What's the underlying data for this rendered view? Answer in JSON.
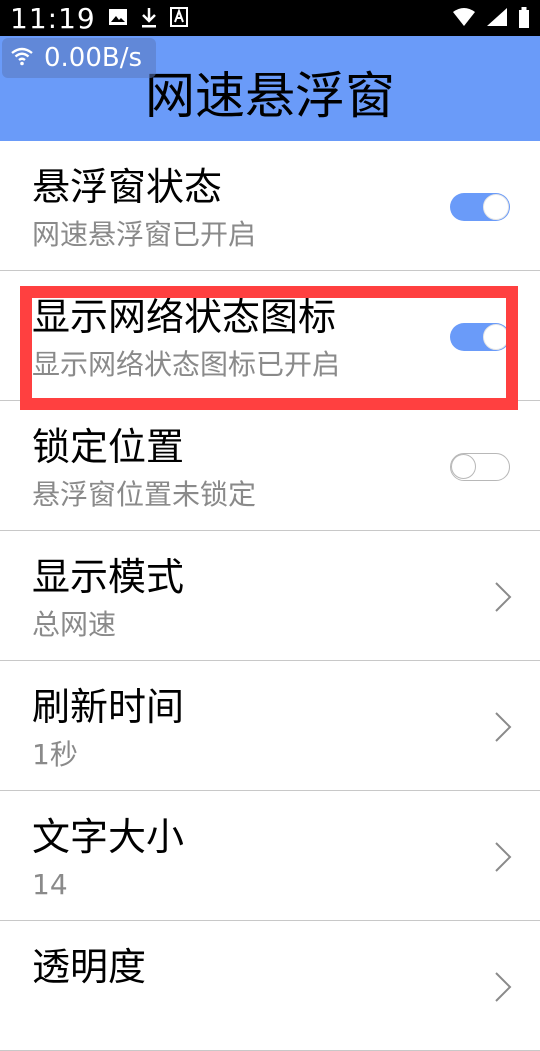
{
  "status_bar": {
    "time": "11:19"
  },
  "overlay": {
    "speed": "0.00B/s"
  },
  "header": {
    "title": "网速悬浮窗"
  },
  "settings": [
    {
      "title": "悬浮窗状态",
      "summary": "网速悬浮窗已开启",
      "control": "toggle",
      "checked": true
    },
    {
      "title": "显示网络状态图标",
      "summary": "显示网络状态图标已开启",
      "control": "toggle",
      "checked": true
    },
    {
      "title": "锁定位置",
      "summary": "悬浮窗位置未锁定",
      "control": "toggle",
      "checked": false
    },
    {
      "title": "显示模式",
      "summary": "总网速",
      "control": "chevron"
    },
    {
      "title": "刷新时间",
      "summary": "1秒",
      "control": "chevron"
    },
    {
      "title": "文字大小",
      "summary": "14",
      "control": "chevron"
    },
    {
      "title": "透明度",
      "summary": "",
      "control": "chevron"
    }
  ],
  "colors": {
    "accent": "#6a9bf9",
    "highlight": "#ff4040",
    "summary_text": "#8a8a8a"
  },
  "icons": {
    "status_left": [
      "image-icon",
      "download-icon",
      "font-icon"
    ],
    "status_right": [
      "wifi-icon",
      "cellular-signal-icon",
      "battery-icon"
    ],
    "overlay": "wifi-icon"
  }
}
